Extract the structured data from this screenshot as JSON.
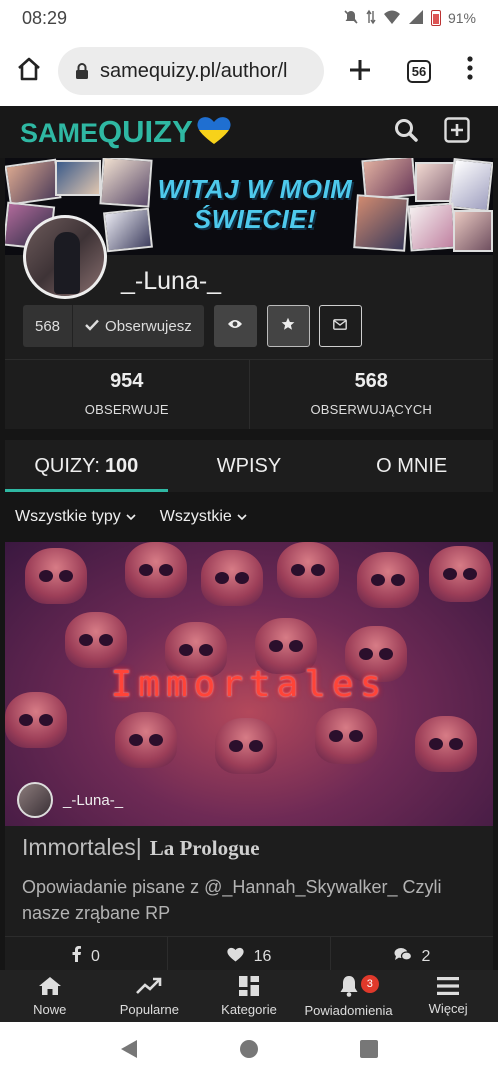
{
  "status_bar": {
    "time": "08:29",
    "battery": "91%"
  },
  "browser": {
    "url": "samequizy.pl/author/l",
    "tab_count": "56"
  },
  "site": {
    "logo_same": "SAME",
    "logo_quizy": "QUIZY"
  },
  "banner": {
    "line1": "WITAJ W MOIM",
    "line2": "ŚWIECIE!"
  },
  "profile": {
    "username": "_-Luna-_",
    "follow_count": "568",
    "follow_label": "Obserwujesz",
    "stats": [
      {
        "value": "954",
        "label": "OBSERWUJE"
      },
      {
        "value": "568",
        "label": "OBSERWUJĄCYCH"
      }
    ]
  },
  "tabs": [
    {
      "label": "QUIZY:",
      "count": "100",
      "active": true
    },
    {
      "label": "WPISY"
    },
    {
      "label": "O MNIE"
    }
  ],
  "filters": [
    "Wszystkie typy",
    "Wszystkie"
  ],
  "quiz_card": {
    "image_text": "Immortales",
    "author": "_-Luna-_",
    "title": "Immortales|",
    "title_sub": "La Prologue",
    "description": "Opowiadanie pisane z @_Hannah_Skywalker_ Czyli nasze zrąbane RP",
    "shares": "0",
    "likes": "16",
    "comments": "2"
  },
  "bottom_nav": [
    {
      "label": "Nowe",
      "icon": "home-icon"
    },
    {
      "label": "Popularne",
      "icon": "trending-icon"
    },
    {
      "label": "Kategorie",
      "icon": "grid-icon"
    },
    {
      "label": "Powiadomienia",
      "icon": "bell-icon",
      "badge": "3"
    },
    {
      "label": "Więcej",
      "icon": "menu-icon"
    }
  ],
  "colors": {
    "accent": "#2fb8a3",
    "background": "#151515",
    "card": "#1d1d1d",
    "badge": "#e0392b"
  }
}
